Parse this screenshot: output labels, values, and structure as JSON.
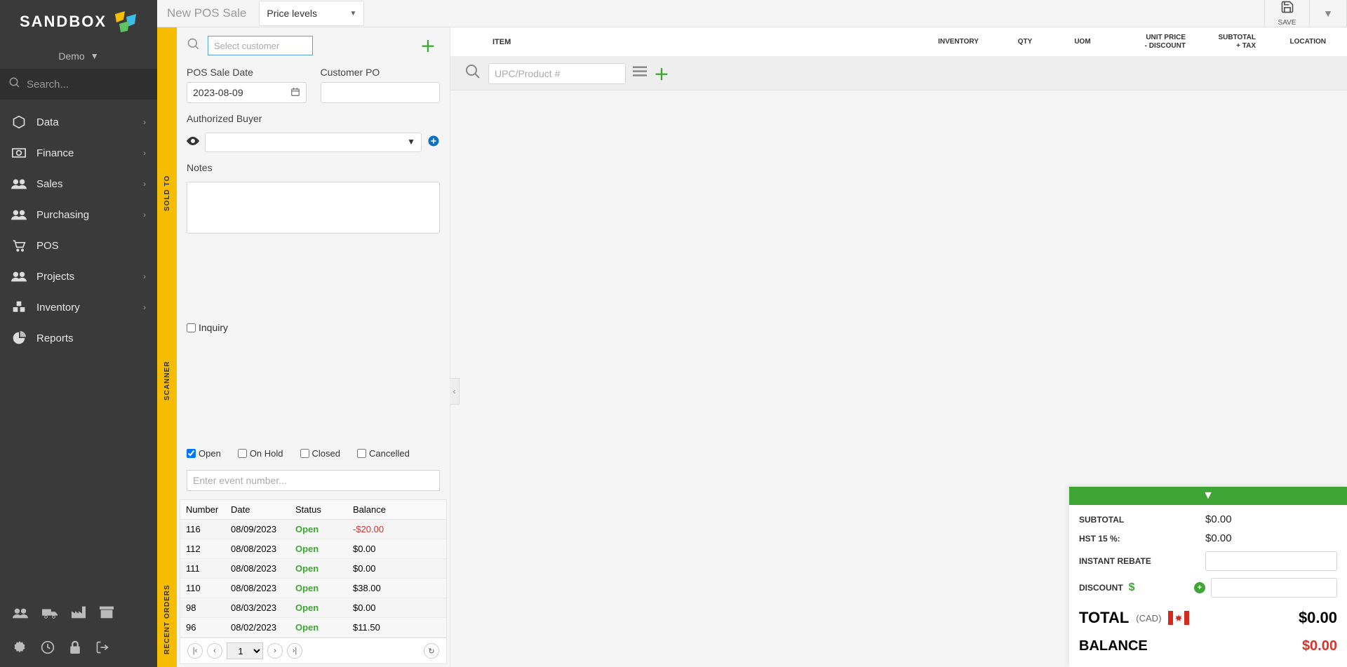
{
  "brand": {
    "name": "SANDBOX"
  },
  "context": {
    "name": "Demo"
  },
  "search": {
    "placeholder": "Search..."
  },
  "nav": {
    "data": "Data",
    "finance": "Finance",
    "sales": "Sales",
    "purchasing": "Purchasing",
    "pos": "POS",
    "projects": "Projects",
    "inventory": "Inventory",
    "reports": "Reports"
  },
  "header": {
    "page_title": "New  POS Sale",
    "price_levels": "Price levels",
    "save_label": "SAVE"
  },
  "yellow_tabs": {
    "sold_to": "SOLD TO",
    "scanner": "SCANNER",
    "recent_orders": "RECENT ORDERS"
  },
  "panel": {
    "select_customer_ph": "Select customer",
    "pos_sale_date_label": "POS Sale Date",
    "pos_sale_date_value": "2023-08-09",
    "customer_po_label": "Customer PO",
    "authorized_buyer_label": "Authorized Buyer",
    "notes_label": "Notes",
    "inquiry_label": "Inquiry",
    "filters": {
      "open": "Open",
      "on_hold": "On Hold",
      "closed": "Closed",
      "cancelled": "Cancelled"
    },
    "event_placeholder": "Enter event number...",
    "table": {
      "headers": {
        "number": "Number",
        "date": "Date",
        "status": "Status",
        "balance": "Balance"
      },
      "rows": [
        {
          "num": "116",
          "date": "08/09/2023",
          "status": "Open",
          "balance": "-$20.00",
          "neg": true
        },
        {
          "num": "112",
          "date": "08/08/2023",
          "status": "Open",
          "balance": "$0.00",
          "neg": false
        },
        {
          "num": "111",
          "date": "08/08/2023",
          "status": "Open",
          "balance": "$0.00",
          "neg": false
        },
        {
          "num": "110",
          "date": "08/08/2023",
          "status": "Open",
          "balance": "$38.00",
          "neg": false
        },
        {
          "num": "98",
          "date": "08/03/2023",
          "status": "Open",
          "balance": "$0.00",
          "neg": false
        },
        {
          "num": "96",
          "date": "08/02/2023",
          "status": "Open",
          "balance": "$11.50",
          "neg": false
        }
      ],
      "page": "1"
    }
  },
  "items_header": {
    "item": "ITEM",
    "inventory": "INVENTORY",
    "qty": "QTY",
    "uom": "UOM",
    "unit_price": "UNIT PRICE",
    "unit_sub": "- DISCOUNT",
    "subtotal": "SUBTOTAL",
    "subtotal_sub": "+ TAX",
    "location": "LOCATION"
  },
  "item_search": {
    "upc_placeholder": "UPC/Product #"
  },
  "totals": {
    "subtotal_label": "SUBTOTAL",
    "subtotal_value": "$0.00",
    "hst_label": "HST 15 %:",
    "hst_value": "$0.00",
    "rebate_label": "INSTANT REBATE",
    "discount_label": "DISCOUNT",
    "total_label": "TOTAL",
    "total_currency": "(CAD)",
    "total_value": "$0.00",
    "balance_label": "BALANCE",
    "balance_value": "$0.00"
  }
}
